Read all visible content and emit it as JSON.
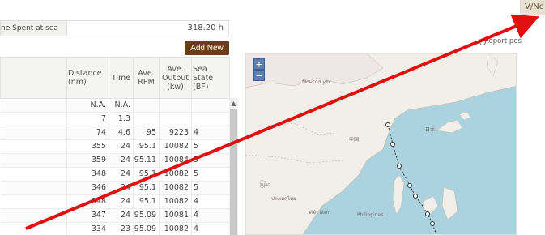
{
  "header": {
    "corner_tab": "V/Nc"
  },
  "summary": {
    "time_at_sea_label": "ne Spent at sea",
    "time_at_sea_value": "318.20 h"
  },
  "toolbar": {
    "add_new_label": "Add New"
  },
  "report_label": "Report pos",
  "table": {
    "columns": [
      {
        "key": "distance",
        "label": "Distance (nm)"
      },
      {
        "key": "time",
        "label": "Time"
      },
      {
        "key": "rpm",
        "label": "Ave. RPM"
      },
      {
        "key": "output",
        "label": "Ave. Output (kw)"
      },
      {
        "key": "sea",
        "label": "Sea State (BF)"
      }
    ],
    "rows": [
      {
        "distance": "N.A.",
        "time": "N.A.",
        "rpm": "",
        "output": "",
        "sea": ""
      },
      {
        "distance": "7",
        "time": "1.3",
        "rpm": "",
        "output": "",
        "sea": ""
      },
      {
        "distance": "74",
        "time": "4.6",
        "rpm": "95",
        "output": "9223",
        "sea": "4"
      },
      {
        "distance": "355",
        "time": "24",
        "rpm": "95.1",
        "output": "10082",
        "sea": "5"
      },
      {
        "distance": "359",
        "time": "24",
        "rpm": "95.11",
        "output": "10084",
        "sea": "5"
      },
      {
        "distance": "348",
        "time": "24",
        "rpm": "95.1",
        "output": "10082",
        "sea": "5"
      },
      {
        "distance": "346",
        "time": "24",
        "rpm": "95.1",
        "output": "10082",
        "sea": "5"
      },
      {
        "distance": "348",
        "time": "24",
        "rpm": "95.1",
        "output": "10082",
        "sea": "4"
      },
      {
        "distance": "347",
        "time": "24",
        "rpm": "95.09",
        "output": "10081",
        "sea": "4"
      },
      {
        "distance": "334",
        "time": "23",
        "rpm": "95.09",
        "output": "10082",
        "sea": "4"
      }
    ]
  },
  "map": {
    "zoom_in": "+",
    "zoom_out": "−",
    "labels": {
      "mongolia": "Монгол улс",
      "china": "中国",
      "japan": "日本",
      "myanmar": "မြန်မာ",
      "thailand": "ประเทศไทย",
      "vietnam": "Việt Nam",
      "philippines": "Philippines"
    }
  },
  "colors": {
    "accent": "#6b3d12",
    "arrow": "#e01010",
    "sea": "#aad3df",
    "land": "#f2efe9"
  }
}
